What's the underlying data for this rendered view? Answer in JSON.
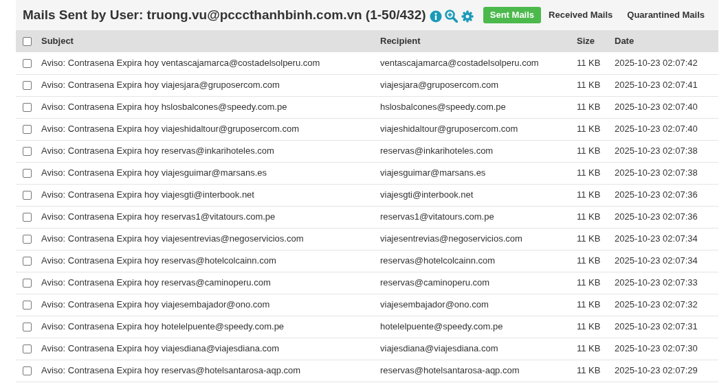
{
  "title": "Mails Sent by User: truong.vu@pcccthanhbinh.com.vn (1-50/432)",
  "tabs": [
    {
      "label": "Sent Mails",
      "selected": true
    },
    {
      "label": "Received Mails",
      "selected": false
    },
    {
      "label": "Quarantined Mails",
      "selected": false
    }
  ],
  "table": {
    "select_all_checked": false,
    "columns": [
      "Subject",
      "Recipient",
      "Size",
      "Date"
    ],
    "rows": [
      {
        "checked": false,
        "subject": "Aviso: Contrasena Expira hoy ventascajamarca@costadelsolperu.com",
        "recipient": "ventascajamarca@costadelsolperu.com",
        "size": "11 KB",
        "date": "2025-10-23 02:07:42"
      },
      {
        "checked": false,
        "subject": "Aviso: Contrasena Expira hoy viajesjara@gruposercom.com",
        "recipient": "viajesjara@gruposercom.com",
        "size": "11 KB",
        "date": "2025-10-23 02:07:41"
      },
      {
        "checked": false,
        "subject": "Aviso: Contrasena Expira hoy hslosbalcones@speedy.com.pe",
        "recipient": "hslosbalcones@speedy.com.pe",
        "size": "11 KB",
        "date": "2025-10-23 02:07:40"
      },
      {
        "checked": false,
        "subject": "Aviso: Contrasena Expira hoy viajeshidaltour@gruposercom.com",
        "recipient": "viajeshidaltour@gruposercom.com",
        "size": "11 KB",
        "date": "2025-10-23 02:07:40"
      },
      {
        "checked": false,
        "subject": "Aviso: Contrasena Expira hoy reservas@inkarihoteles.com",
        "recipient": "reservas@inkarihoteles.com",
        "size": "11 KB",
        "date": "2025-10-23 02:07:38"
      },
      {
        "checked": false,
        "subject": "Aviso: Contrasena Expira hoy viajesguimar@marsans.es",
        "recipient": "viajesguimar@marsans.es",
        "size": "11 KB",
        "date": "2025-10-23 02:07:38"
      },
      {
        "checked": false,
        "subject": "Aviso: Contrasena Expira hoy viajesgti@interbook.net",
        "recipient": "viajesgti@interbook.net",
        "size": "11 KB",
        "date": "2025-10-23 02:07:36"
      },
      {
        "checked": false,
        "subject": "Aviso: Contrasena Expira hoy reservas1@vitatours.com.pe",
        "recipient": "reservas1@vitatours.com.pe",
        "size": "11 KB",
        "date": "2025-10-23 02:07:36"
      },
      {
        "checked": false,
        "subject": "Aviso: Contrasena Expira hoy viajesentrevias@negoservicios.com",
        "recipient": "viajesentrevias@negoservicios.com",
        "size": "11 KB",
        "date": "2025-10-23 02:07:34"
      },
      {
        "checked": false,
        "subject": "Aviso: Contrasena Expira hoy reservas@hotelcolcainn.com",
        "recipient": "reservas@hotelcolcainn.com",
        "size": "11 KB",
        "date": "2025-10-23 02:07:34"
      },
      {
        "checked": false,
        "subject": "Aviso: Contrasena Expira hoy reservas@caminoperu.com",
        "recipient": "reservas@caminoperu.com",
        "size": "11 KB",
        "date": "2025-10-23 02:07:33"
      },
      {
        "checked": false,
        "subject": "Aviso: Contrasena Expira hoy viajesembajador@ono.com",
        "recipient": "viajesembajador@ono.com",
        "size": "11 KB",
        "date": "2025-10-23 02:07:32"
      },
      {
        "checked": false,
        "subject": "Aviso: Contrasena Expira hoy hotelelpuente@speedy.com.pe",
        "recipient": "hotelelpuente@speedy.com.pe",
        "size": "11 KB",
        "date": "2025-10-23 02:07:31"
      },
      {
        "checked": false,
        "subject": "Aviso: Contrasena Expira hoy viajesdiana@viajesdiana.com",
        "recipient": "viajesdiana@viajesdiana.com",
        "size": "11 KB",
        "date": "2025-10-23 02:07:30"
      },
      {
        "checked": false,
        "subject": "Aviso: Contrasena Expira hoy reservas@hotelsantarosa-aqp.com",
        "recipient": "reservas@hotelsantarosa-aqp.com",
        "size": "11 KB",
        "date": "2025-10-23 02:07:29"
      }
    ]
  }
}
